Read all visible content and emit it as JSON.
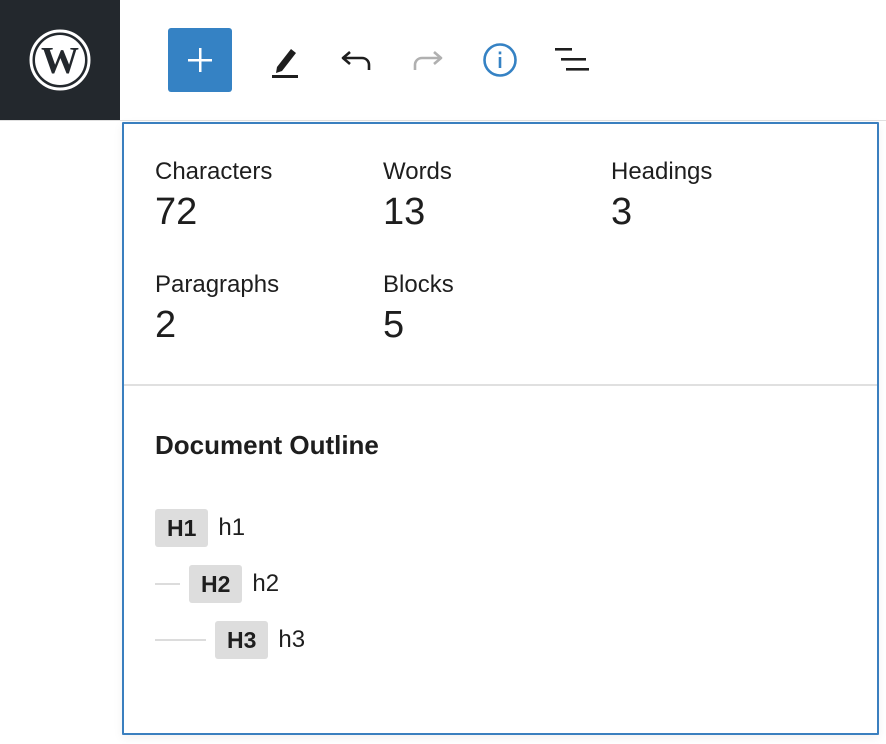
{
  "toolbar": {
    "logo_icon": "wordpress-logo-icon",
    "buttons": [
      {
        "name": "add-block",
        "icon": "plus-icon"
      },
      {
        "name": "tools",
        "icon": "pencil-icon"
      },
      {
        "name": "undo",
        "icon": "undo-icon"
      },
      {
        "name": "redo",
        "icon": "redo-icon",
        "disabled": true
      },
      {
        "name": "details",
        "icon": "info-icon",
        "active": true
      },
      {
        "name": "list-view",
        "icon": "list-view-icon"
      }
    ],
    "colors": {
      "logo_bg": "#23282d",
      "accent": "#3582c4",
      "disabled": "#b0b0b0"
    }
  },
  "stats": {
    "characters": {
      "label": "Characters",
      "value": "72"
    },
    "words": {
      "label": "Words",
      "value": "13"
    },
    "headings": {
      "label": "Headings",
      "value": "3"
    },
    "paragraphs": {
      "label": "Paragraphs",
      "value": "2"
    },
    "blocks": {
      "label": "Blocks",
      "value": "5"
    }
  },
  "outline": {
    "title": "Document Outline",
    "items": [
      {
        "level": "H1",
        "text": "h1"
      },
      {
        "level": "H2",
        "text": "h2"
      },
      {
        "level": "H3",
        "text": "h3"
      }
    ]
  }
}
